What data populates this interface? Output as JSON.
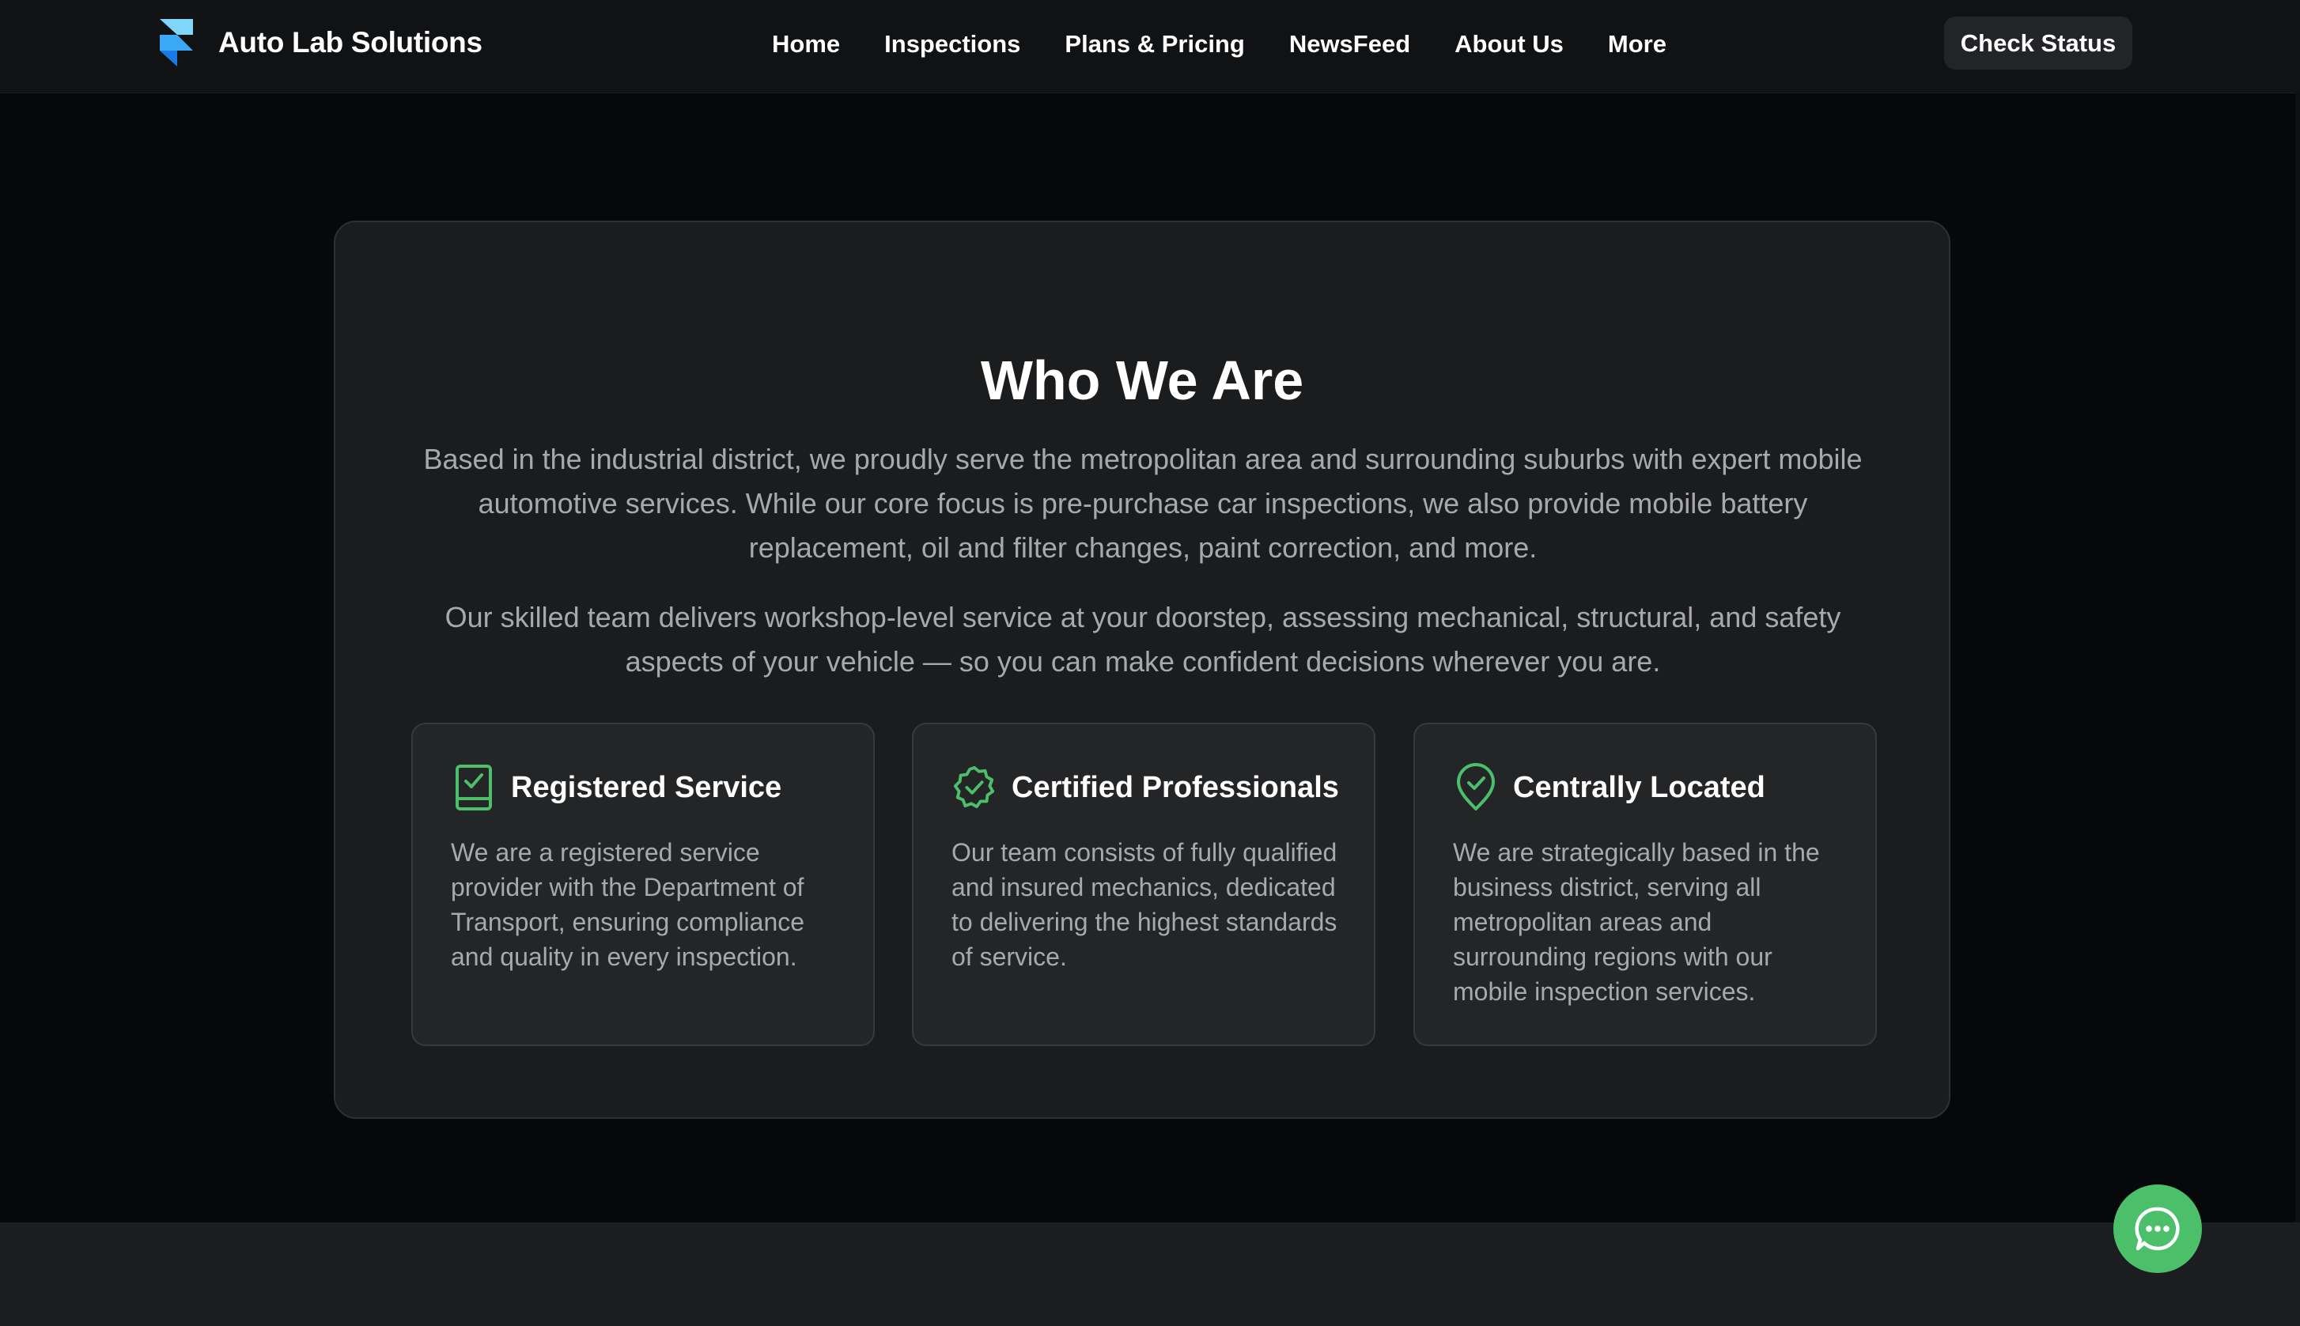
{
  "brand": {
    "name": "Auto Lab Solutions",
    "logo_icon": "framer-logo-icon"
  },
  "nav": {
    "items": [
      {
        "label": "Home"
      },
      {
        "label": "Inspections"
      },
      {
        "label": "Plans & Pricing"
      },
      {
        "label": "NewsFeed"
      },
      {
        "label": "About Us"
      },
      {
        "label": "More"
      }
    ],
    "cta_label": "Check Status"
  },
  "about": {
    "title": "Who We Are",
    "paragraphs": [
      "Based in the industrial district, we proudly serve the metropolitan area and surrounding suburbs with expert mobile automotive services. While our core focus is pre-purchase car inspections, we also provide mobile battery replacement, oil and filter changes, paint correction, and more.",
      "Our skilled team delivers workshop-level service at your doorstep, assessing mechanical, structural, and safety aspects of your vehicle — so you can make confident decisions wherever you are."
    ],
    "features": [
      {
        "icon": "clipboard-check-icon",
        "title": "Registered Service",
        "description": "We are a registered service provider with the Department of Transport, ensuring compliance and quality in every inspection."
      },
      {
        "icon": "badge-check-icon",
        "title": "Certified Professionals",
        "description": "Our team consists of fully qualified and insured mechanics, dedicated to delivering the highest standards of service."
      },
      {
        "icon": "location-check-icon",
        "title": "Centrally Located",
        "description": "We are strategically based in the business district, serving all metropolitan areas and surrounding regions with our mobile inspection services."
      }
    ]
  },
  "chat": {
    "icon": "chat-bubble-icon"
  },
  "colors": {
    "background": "#07080a",
    "navbar": "#111214",
    "card": "#1b1c1e",
    "feature_card": "#242527",
    "accent_green": "#4cbf6b",
    "text_muted": "#a8a9ad",
    "logo_light_blue": "#6fd0f6",
    "logo_blue": "#1f8cf0"
  }
}
